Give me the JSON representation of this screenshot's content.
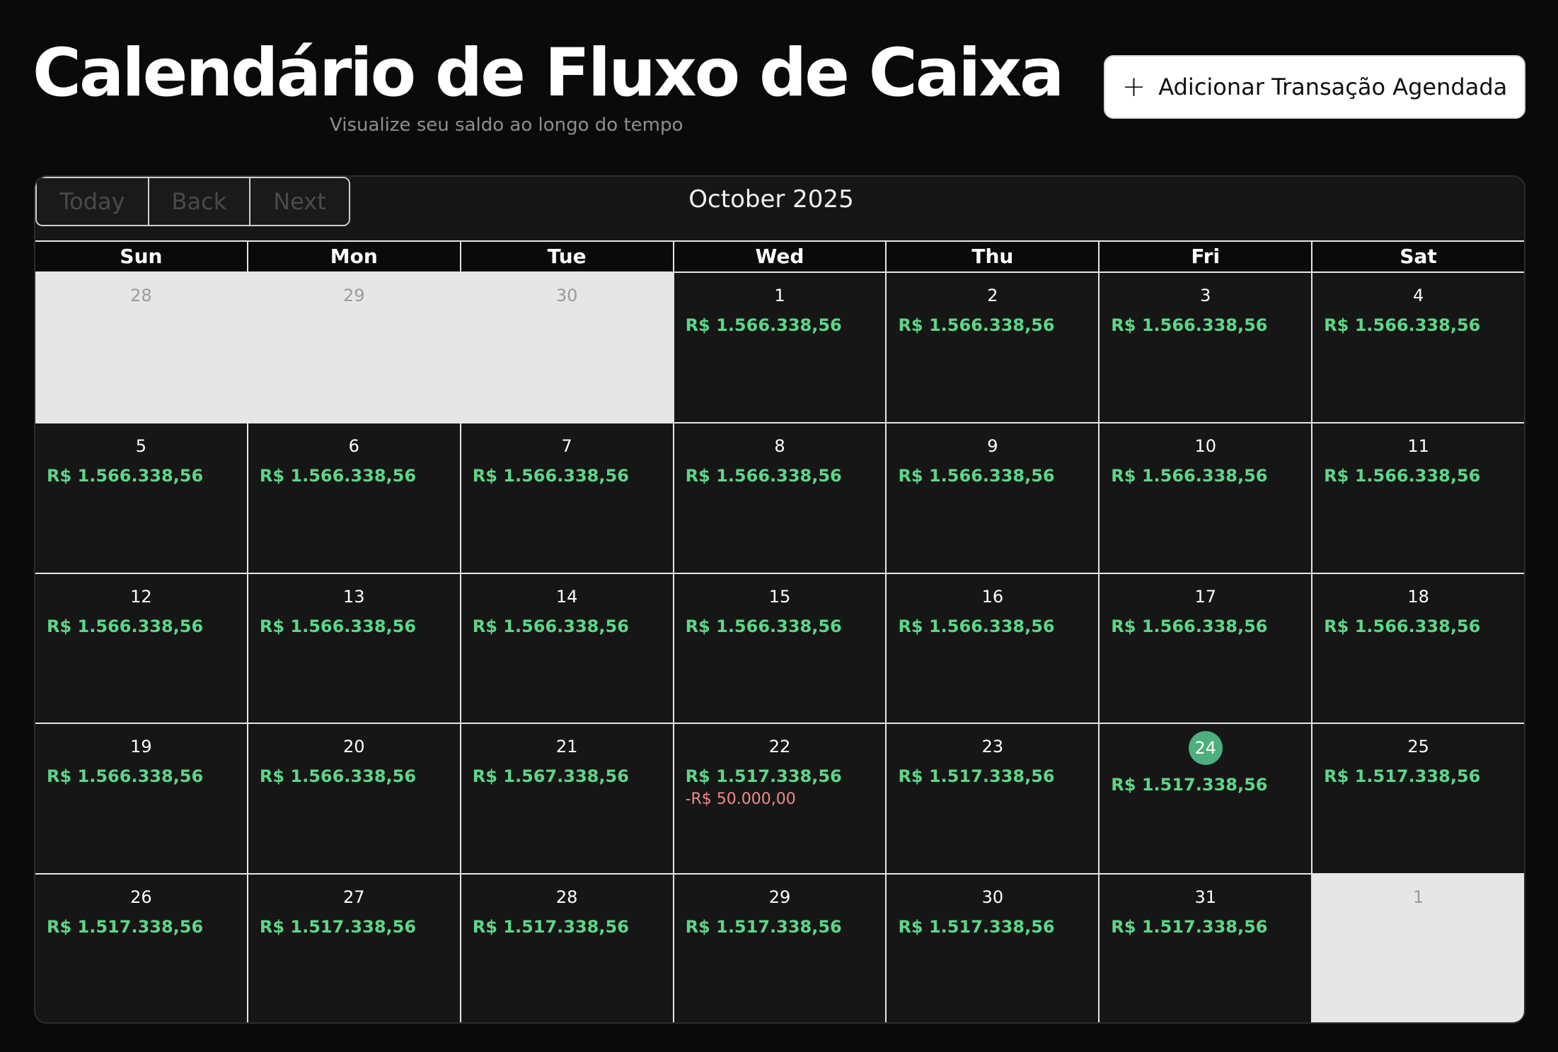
{
  "header": {
    "title": "Calendário de Fluxo de Caixa",
    "subtitle": "Visualize seu saldo ao longo do tempo",
    "add_button_label": "Adicionar Transação Agendada",
    "add_button_icon": "plus-icon"
  },
  "toolbar": {
    "today_label": "Today",
    "back_label": "Back",
    "next_label": "Next",
    "month_label": "October 2025"
  },
  "colors": {
    "background": "#0a0a0a",
    "surface": "#161616",
    "positive": "#5dd687",
    "negative": "#f08a8a",
    "today_marker": "#4caf7d",
    "off_range_day": "#e6e6e6"
  },
  "weekdays": [
    "Sun",
    "Mon",
    "Tue",
    "Wed",
    "Thu",
    "Fri",
    "Sat"
  ],
  "weeks": [
    [
      {
        "day": "28",
        "off": true
      },
      {
        "day": "29",
        "off": true
      },
      {
        "day": "30",
        "off": true
      },
      {
        "day": "1",
        "balance": "R$ 1.566.338,56"
      },
      {
        "day": "2",
        "balance": "R$ 1.566.338,56"
      },
      {
        "day": "3",
        "balance": "R$ 1.566.338,56"
      },
      {
        "day": "4",
        "balance": "R$ 1.566.338,56"
      }
    ],
    [
      {
        "day": "5",
        "balance": "R$ 1.566.338,56"
      },
      {
        "day": "6",
        "balance": "R$ 1.566.338,56"
      },
      {
        "day": "7",
        "balance": "R$ 1.566.338,56"
      },
      {
        "day": "8",
        "balance": "R$ 1.566.338,56"
      },
      {
        "day": "9",
        "balance": "R$ 1.566.338,56"
      },
      {
        "day": "10",
        "balance": "R$ 1.566.338,56"
      },
      {
        "day": "11",
        "balance": "R$ 1.566.338,56"
      }
    ],
    [
      {
        "day": "12",
        "balance": "R$ 1.566.338,56"
      },
      {
        "day": "13",
        "balance": "R$ 1.566.338,56"
      },
      {
        "day": "14",
        "balance": "R$ 1.566.338,56"
      },
      {
        "day": "15",
        "balance": "R$ 1.566.338,56"
      },
      {
        "day": "16",
        "balance": "R$ 1.566.338,56"
      },
      {
        "day": "17",
        "balance": "R$ 1.566.338,56"
      },
      {
        "day": "18",
        "balance": "R$ 1.566.338,56"
      }
    ],
    [
      {
        "day": "19",
        "balance": "R$ 1.566.338,56"
      },
      {
        "day": "20",
        "balance": "R$ 1.566.338,56"
      },
      {
        "day": "21",
        "balance": "R$ 1.567.338,56"
      },
      {
        "day": "22",
        "balance": "R$ 1.517.338,56",
        "expense": "-R$ 50.000,00"
      },
      {
        "day": "23",
        "balance": "R$ 1.517.338,56"
      },
      {
        "day": "24",
        "balance": "R$ 1.517.338,56",
        "today": true
      },
      {
        "day": "25",
        "balance": "R$ 1.517.338,56"
      }
    ],
    [
      {
        "day": "26",
        "balance": "R$ 1.517.338,56"
      },
      {
        "day": "27",
        "balance": "R$ 1.517.338,56"
      },
      {
        "day": "28",
        "balance": "R$ 1.517.338,56"
      },
      {
        "day": "29",
        "balance": "R$ 1.517.338,56"
      },
      {
        "day": "30",
        "balance": "R$ 1.517.338,56"
      },
      {
        "day": "31",
        "balance": "R$ 1.517.338,56"
      },
      {
        "day": "1",
        "off": true
      }
    ]
  ]
}
